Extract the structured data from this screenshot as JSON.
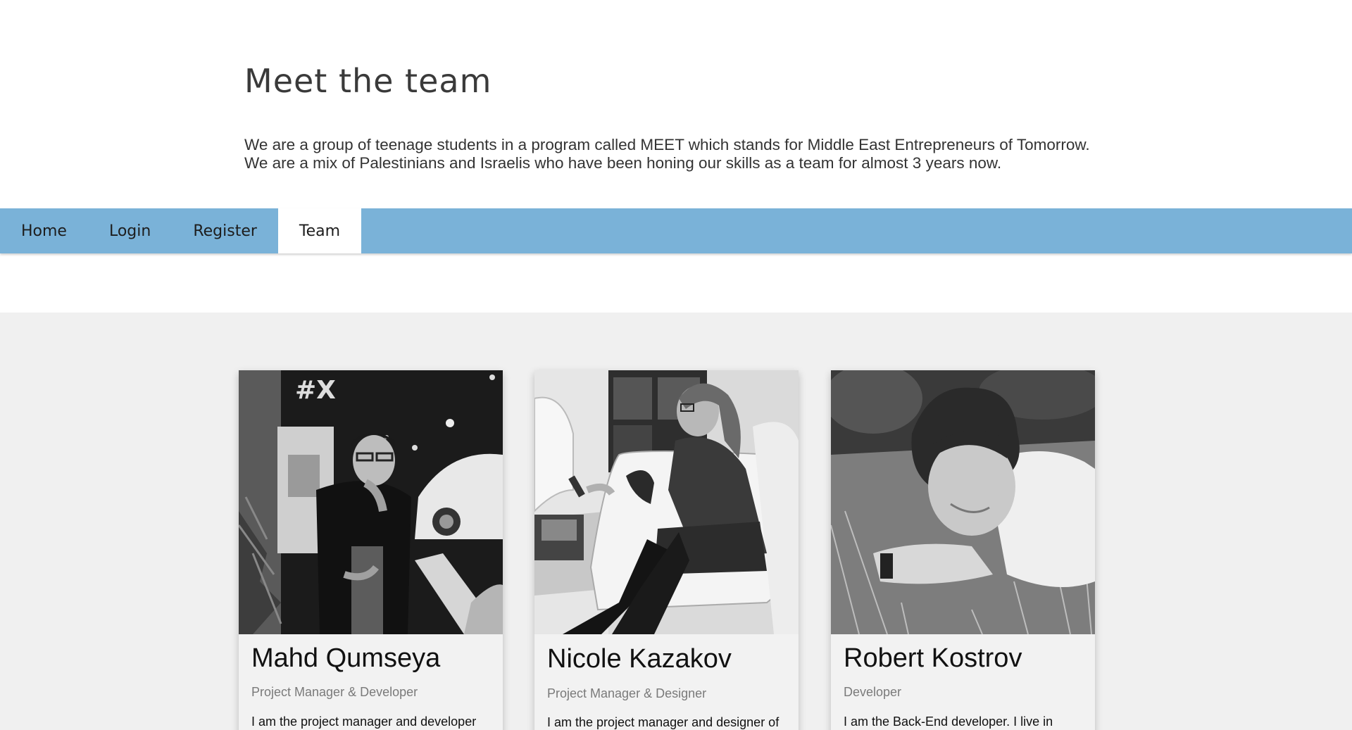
{
  "header": {
    "title": "Meet the team",
    "intro": "We are a group of teenage students in a program called MEET which stands for Middle East Entrepreneurs of Tomorrow. We are a mix of Palestinians and Israelis who have been honing our skills as a team for almost 3 years now."
  },
  "nav": {
    "items": [
      {
        "label": "Home"
      },
      {
        "label": "Login"
      },
      {
        "label": "Register"
      },
      {
        "label": "Team",
        "active": true
      }
    ],
    "bar_color": "#7ab2d8"
  },
  "team": [
    {
      "name": "Mahd Qumseya",
      "role": "Project Manager & Developer",
      "bio": "I am the project manager and developer"
    },
    {
      "name": "Nicole Kazakov",
      "role": "Project Manager & Designer",
      "bio": "I am the project manager and designer of"
    },
    {
      "name": "Robert Kostrov",
      "role": "Developer",
      "bio": "I am the Back-End developer. I live in"
    }
  ]
}
